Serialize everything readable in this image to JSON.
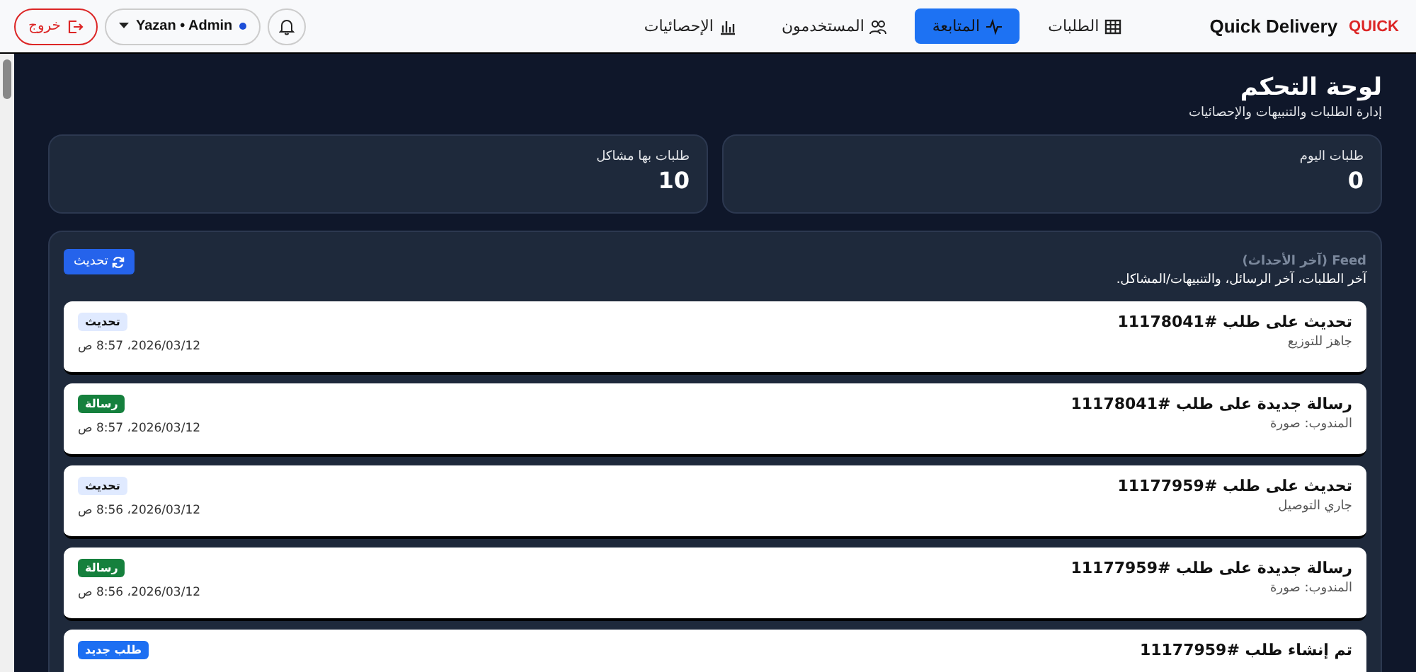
{
  "brand": {
    "logo_text": "QUICK",
    "name": "Quick Delivery"
  },
  "nav": [
    {
      "label": "الطلبات",
      "kind": "table",
      "selected": false
    },
    {
      "label": "المتابعة",
      "kind": "pulse",
      "selected": true
    },
    {
      "label": "المستخدمون",
      "kind": "users",
      "selected": false
    },
    {
      "label": "الإحصائيات",
      "kind": "chart",
      "selected": false
    }
  ],
  "user": {
    "label": "Yazan • Admin",
    "online": true
  },
  "logout": "خروج",
  "page": {
    "title": "لوحة التحكم",
    "subtitle": "إدارة الطلبات والتنبيهات والإحصائيات"
  },
  "stats": [
    {
      "label": "طلبات اليوم",
      "value": "0"
    },
    {
      "label": "طلبات بها مشاكل",
      "value": "10"
    }
  ],
  "feed": {
    "title": "Feed (آخر الأحداث)",
    "description": "آخر الطلبات، آخر الرسائل، والتنبيهات/المشاكل.",
    "refresh": "تحديث",
    "items": [
      {
        "title": "تحديث على طلب #11178041",
        "detail": "جاهز للتوزيع",
        "badge": "تحديث",
        "kind": "update",
        "time": "2026/03/12، 8:57 ص"
      },
      {
        "title": "رسالة جديدة على طلب #11178041",
        "detail": "المندوب: صورة",
        "badge": "رسالة",
        "kind": "message",
        "time": "2026/03/12، 8:57 ص"
      },
      {
        "title": "تحديث على طلب #11177959",
        "detail": "جاري التوصيل",
        "badge": "تحديث",
        "kind": "update",
        "time": "2026/03/12، 8:56 ص"
      },
      {
        "title": "رسالة جديدة على طلب #11177959",
        "detail": "المندوب: صورة",
        "badge": "رسالة",
        "kind": "message",
        "time": "2026/03/12، 8:56 ص"
      },
      {
        "title": "تم إنشاء طلب #11177959",
        "badge": "طلب جديد",
        "kind": "new"
      }
    ]
  }
}
